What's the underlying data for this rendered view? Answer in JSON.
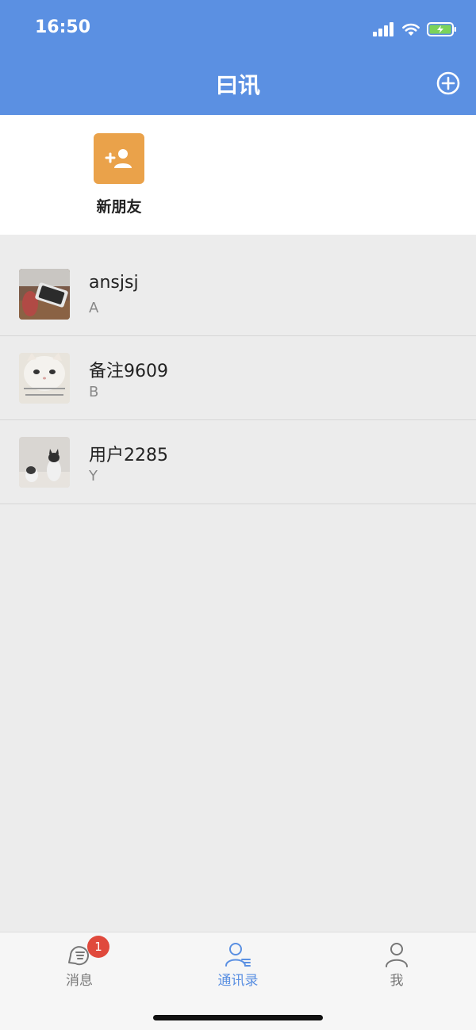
{
  "status": {
    "time": "16:50"
  },
  "header": {
    "title": "曰讯"
  },
  "quick_actions": {
    "new_friend_label": "新朋友"
  },
  "contacts": [
    {
      "name": "ansjsj",
      "letter": "A"
    },
    {
      "name": "备注9609",
      "letter": "B"
    },
    {
      "name": "用户2285",
      "letter": "Y"
    }
  ],
  "tabs": [
    {
      "label": "消息",
      "badge": "1",
      "active": false
    },
    {
      "label": "通讯录",
      "active": true
    },
    {
      "label": "我",
      "active": false
    }
  ],
  "colors": {
    "primary": "#5b90e2",
    "accent": "#eaa24a",
    "badge": "#e0493c",
    "background": "#ececec"
  }
}
